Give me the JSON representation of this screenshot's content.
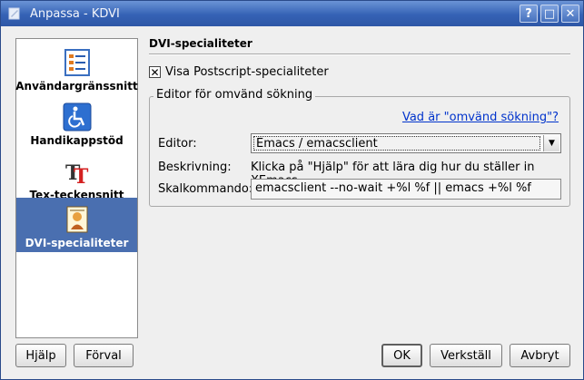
{
  "window": {
    "title": "Anpassa - KDVI",
    "controls": {
      "help": "?",
      "maximize": "□",
      "close": "✕"
    }
  },
  "sidebar": {
    "items": [
      {
        "label": "Användargränssnitt",
        "icon": "list-settings-icon"
      },
      {
        "label": "Handikappstöd",
        "icon": "accessibility-icon"
      },
      {
        "label": "Tex-teckensnitt",
        "icon": "tex-font-icon"
      },
      {
        "label": "DVI-specialiteter",
        "icon": "dvi-document-icon",
        "selected": true
      }
    ]
  },
  "main": {
    "section_title": "DVI-specialiteter",
    "postscript_checkbox": {
      "label": "Visa Postscript-specialiteter",
      "checked": true,
      "mark": "✕"
    },
    "group": {
      "legend": "Editor för omvänd sökning",
      "help_link": "Vad är \"omvänd sökning\"?",
      "editor_label": "Editor:",
      "editor_value": "Emacs / emacsclient",
      "description_label": "Beskrivning:",
      "description_text": "Klicka på \"Hjälp\" för att lära dig hur du ställer in XEmacs.",
      "command_label": "Skalkommando:",
      "command_value": "emacsclient --no-wait +%l %f || emacs +%l %f"
    }
  },
  "buttons": {
    "help": "Hjälp",
    "defaults": "Förval",
    "ok": "OK",
    "apply": "Verkställ",
    "cancel": "Avbryt"
  },
  "colors": {
    "titlebar": "#3562b5",
    "selection": "#4a6fb0",
    "link": "#0033cc"
  }
}
